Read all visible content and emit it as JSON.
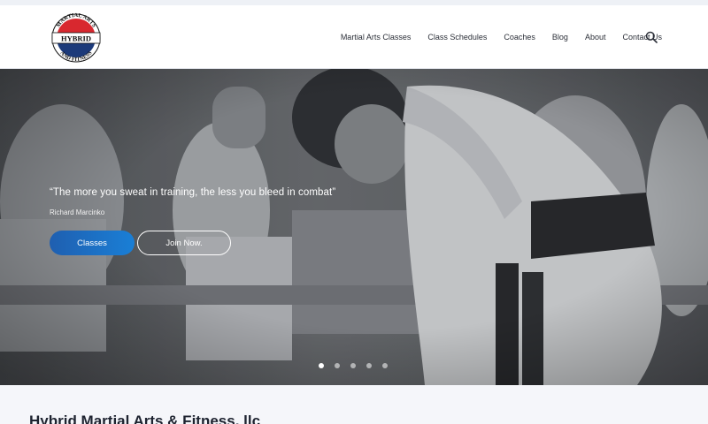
{
  "brand": {
    "logo_text_top": "MARTIAL ARTS",
    "logo_text_middle": "HYBRID",
    "logo_text_bottom": "AND FITNESS",
    "colors": {
      "red": "#d8282f",
      "navy": "#1c3a7a",
      "black": "#111111"
    }
  },
  "nav": {
    "items": [
      "Martial Arts Classes",
      "Class Schedules",
      "Coaches",
      "Blog",
      "About",
      "Contact Us"
    ],
    "search_icon": "search-icon"
  },
  "hero": {
    "quote": "“The more you sweat in training, the less you bleed in combat”",
    "author": "Richard Marcinko",
    "primary_button": "Classes",
    "secondary_button": "Join Now.",
    "slides_total": 5,
    "active_slide": 1,
    "accent": "#1a6fc6"
  },
  "company": {
    "name": "Hybrid Martial Arts & Fitness, llc"
  }
}
